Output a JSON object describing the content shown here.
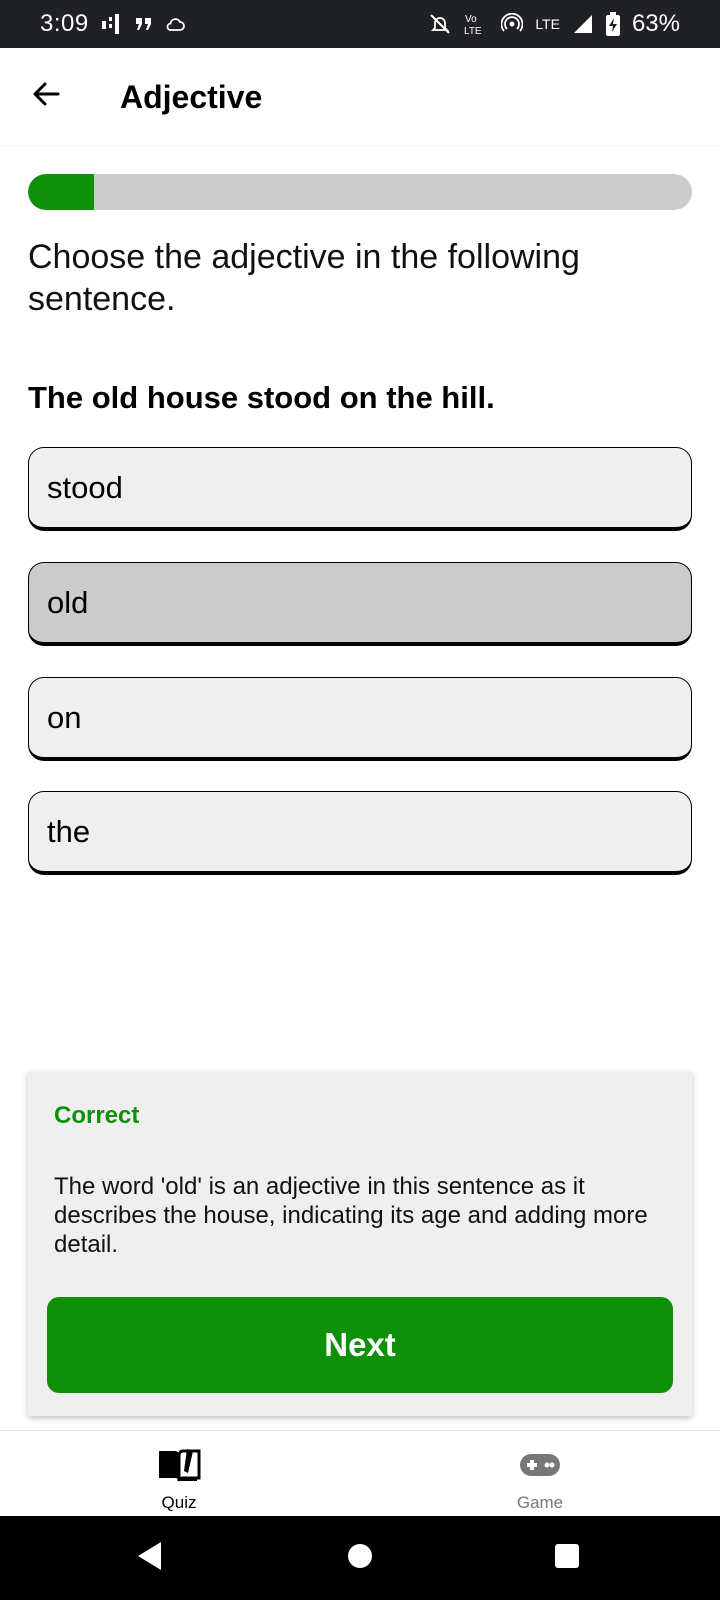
{
  "status_bar": {
    "time": "3:09",
    "network_label": "LTE",
    "battery_percent": "63%",
    "icons": [
      "signal-bars-icon",
      "quote-icon",
      "cloud-icon",
      "mute-icon",
      "volte-icon",
      "hotspot-icon",
      "cell-signal-icon",
      "battery-charging-icon"
    ]
  },
  "app_bar": {
    "title": "Adjective"
  },
  "progress": {
    "fraction": 0.1,
    "color": "#108f0a",
    "track_color": "#cccccc"
  },
  "quiz": {
    "instruction": "Choose the adjective in the following sentence.",
    "question": "The old house stood on the hill.",
    "options": [
      {
        "label": "stood",
        "selected": false
      },
      {
        "label": "old",
        "selected": true
      },
      {
        "label": "on",
        "selected": false
      },
      {
        "label": "the",
        "selected": false
      }
    ]
  },
  "feedback": {
    "title": "Correct",
    "text": "The word 'old' is an adjective in this sentence as it describes the house, indicating its age and adding more detail.",
    "next_label": "Next",
    "accent": "#108f0a"
  },
  "bottom_nav": {
    "items": [
      {
        "label": "Quiz",
        "icon": "book-icon",
        "active": true
      },
      {
        "label": "Game",
        "icon": "gamepad-icon",
        "active": false
      }
    ]
  }
}
